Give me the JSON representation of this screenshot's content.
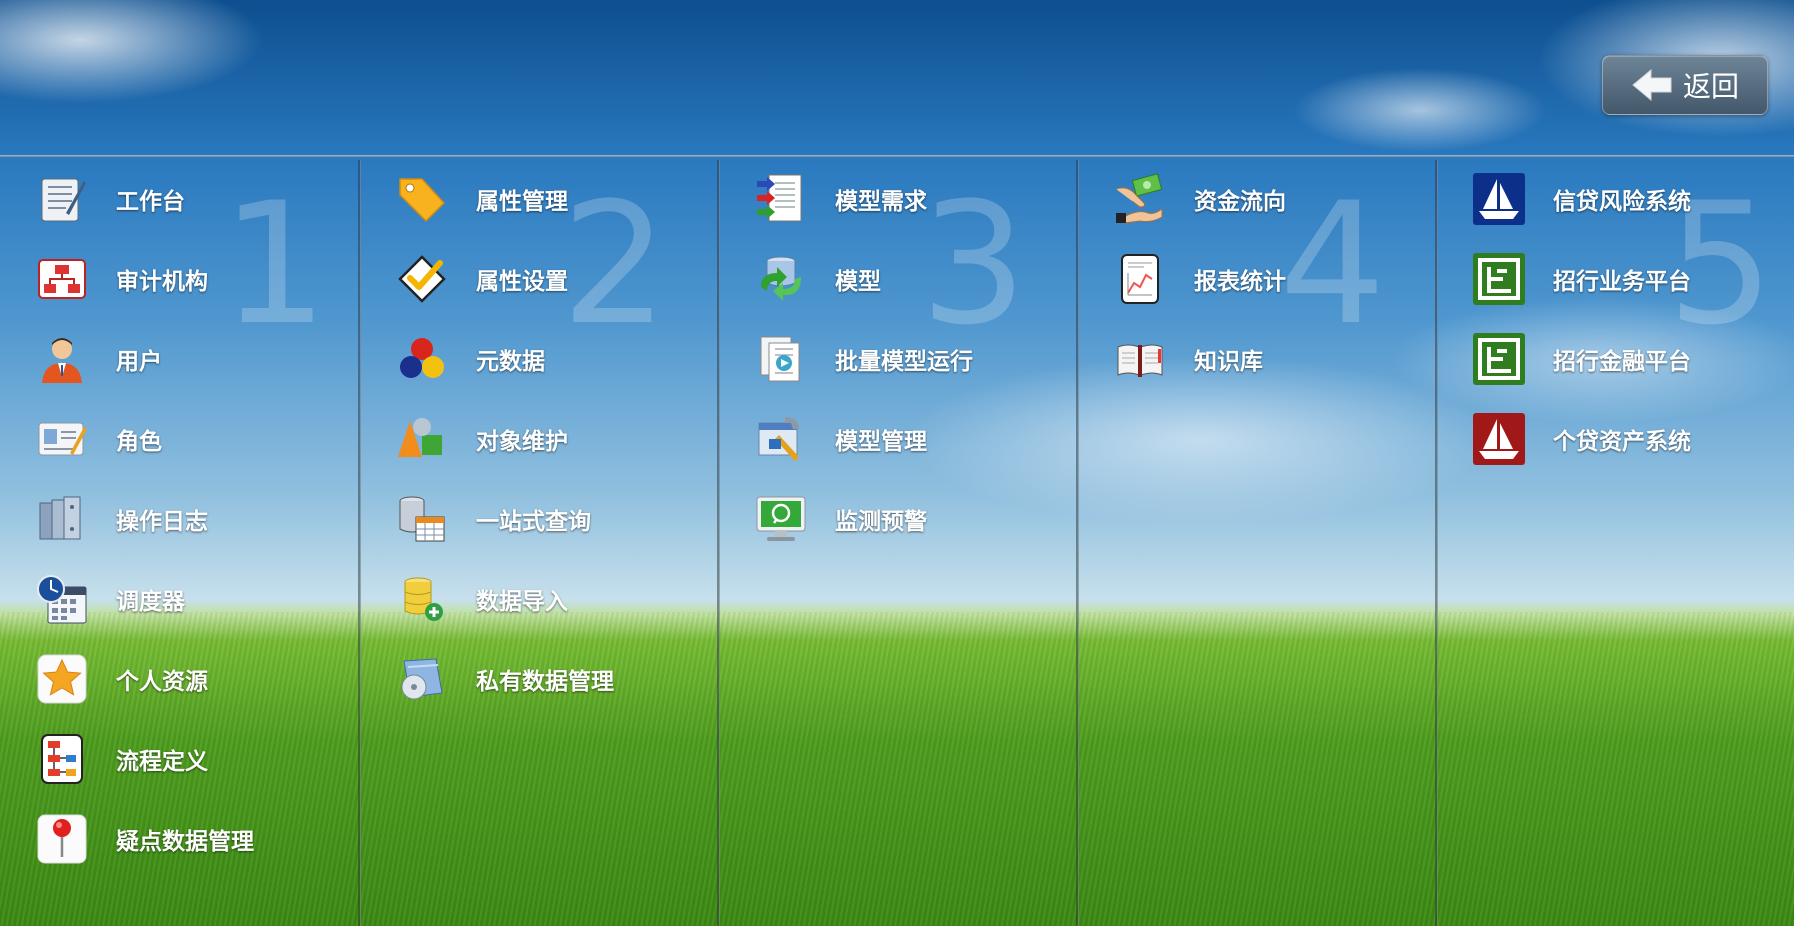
{
  "back_button": {
    "label": "返回",
    "icon": "arrow-left-icon"
  },
  "columns": [
    {
      "number": "1",
      "items": [
        {
          "label": "工作台",
          "icon": "notepad-icon"
        },
        {
          "label": "审计机构",
          "icon": "org-chart-icon"
        },
        {
          "label": "用户",
          "icon": "user-icon"
        },
        {
          "label": "角色",
          "icon": "id-card-icon"
        },
        {
          "label": "操作日志",
          "icon": "binders-icon"
        },
        {
          "label": "调度器",
          "icon": "clock-calendar-icon"
        },
        {
          "label": "个人资源",
          "icon": "star-icon"
        },
        {
          "label": "流程定义",
          "icon": "flowchart-icon"
        },
        {
          "label": "疑点数据管理",
          "icon": "pushpin-icon"
        }
      ]
    },
    {
      "number": "2",
      "items": [
        {
          "label": "属性管理",
          "icon": "tag-icon"
        },
        {
          "label": "属性设置",
          "icon": "checkbox-icon"
        },
        {
          "label": "元数据",
          "icon": "spheres-icon"
        },
        {
          "label": "对象维护",
          "icon": "shapes-icon"
        },
        {
          "label": "一站式查询",
          "icon": "database-table-icon"
        },
        {
          "label": "数据导入",
          "icon": "database-add-icon"
        },
        {
          "label": "私有数据管理",
          "icon": "disc-folder-icon"
        }
      ]
    },
    {
      "number": "3",
      "items": [
        {
          "label": "模型需求",
          "icon": "document-arrows-icon"
        },
        {
          "label": "模型",
          "icon": "database-refresh-icon"
        },
        {
          "label": "批量模型运行",
          "icon": "documents-play-icon"
        },
        {
          "label": "模型管理",
          "icon": "tools-icon"
        },
        {
          "label": "监测预警",
          "icon": "monitor-icon"
        }
      ]
    },
    {
      "number": "4",
      "items": [
        {
          "label": "资金流向",
          "icon": "money-hand-icon"
        },
        {
          "label": "报表统计",
          "icon": "report-chart-icon"
        },
        {
          "label": "知识库",
          "icon": "book-icon"
        }
      ]
    },
    {
      "number": "5",
      "items": [
        {
          "label": "信贷风险系统",
          "icon": "sailboat-blue-icon"
        },
        {
          "label": "招行业务平台",
          "icon": "green-app-icon"
        },
        {
          "label": "招行金融平台",
          "icon": "green-app-icon"
        },
        {
          "label": "个贷资产系统",
          "icon": "sailboat-red-icon"
        }
      ]
    }
  ]
}
